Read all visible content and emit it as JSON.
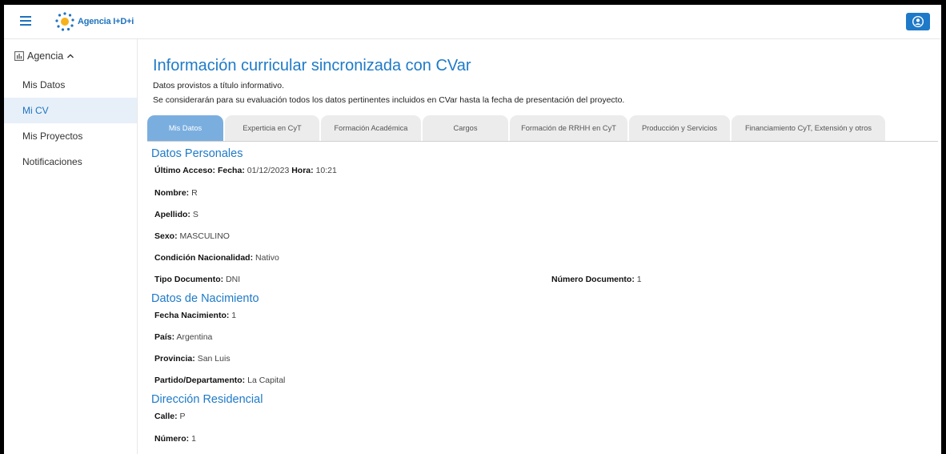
{
  "header": {
    "logo_text": "Agencia I+D+i",
    "menu_icon": "hamburger-menu-icon",
    "user_icon": "user-circle-icon",
    "accent_color": "#1e7ac8"
  },
  "sidebar": {
    "group_label": "Agencia",
    "group_icon": "dashboard-icon",
    "items": [
      {
        "label": "Mis Datos"
      },
      {
        "label": "Mi CV"
      },
      {
        "label": "Mis Proyectos"
      },
      {
        "label": "Notificaciones"
      }
    ],
    "active_item": "Mi CV"
  },
  "main": {
    "title": "Información curricular sincronizada con CVar",
    "subtitle1": "Datos provistos a título informativo.",
    "subtitle2": "Se considerarán para su evaluación todos los datos pertinentes incluidos en CVar hasta la fecha de presentación del proyecto.",
    "tabs": [
      {
        "label": "Mis Datos"
      },
      {
        "label": "Experticia en CyT"
      },
      {
        "label": "Formación Académica"
      },
      {
        "label": "Cargos"
      },
      {
        "label": "Formación de RRHH en CyT"
      },
      {
        "label": "Producción y Servicios"
      },
      {
        "label": "Financiamiento CyT, Extensión y otros"
      }
    ],
    "active_tab": "Mis Datos",
    "personal": {
      "title": "Datos Personales",
      "last_access_label": "Último Acceso:",
      "date_label": "Fecha:",
      "date_value": "01/12/2023",
      "time_label": "Hora:",
      "time_value": "10:21",
      "nombre_label": "Nombre:",
      "nombre_value": "R",
      "apellido_label": "Apellido:",
      "apellido_value": "S",
      "sexo_label": "Sexo:",
      "sexo_value": "MASCULINO",
      "nacionalidad_label": "Condición Nacionalidad:",
      "nacionalidad_value": "Nativo",
      "tipo_doc_label": "Tipo Documento:",
      "tipo_doc_value": "DNI",
      "num_doc_label": "Número Documento:",
      "num_doc_value": "1"
    },
    "birth": {
      "title": "Datos de Nacimiento",
      "fecha_label": "Fecha Nacimiento:",
      "fecha_value": "1",
      "pais_label": "País:",
      "pais_value": "Argentina",
      "provincia_label": "Provincia:",
      "provincia_value": "San Luis",
      "partido_label": "Partido/Departamento:",
      "partido_value": "La Capital"
    },
    "address": {
      "title": "Dirección Residencial",
      "calle_label": "Calle:",
      "calle_value": "P",
      "numero_label": "Número:",
      "numero_value": "1"
    }
  }
}
